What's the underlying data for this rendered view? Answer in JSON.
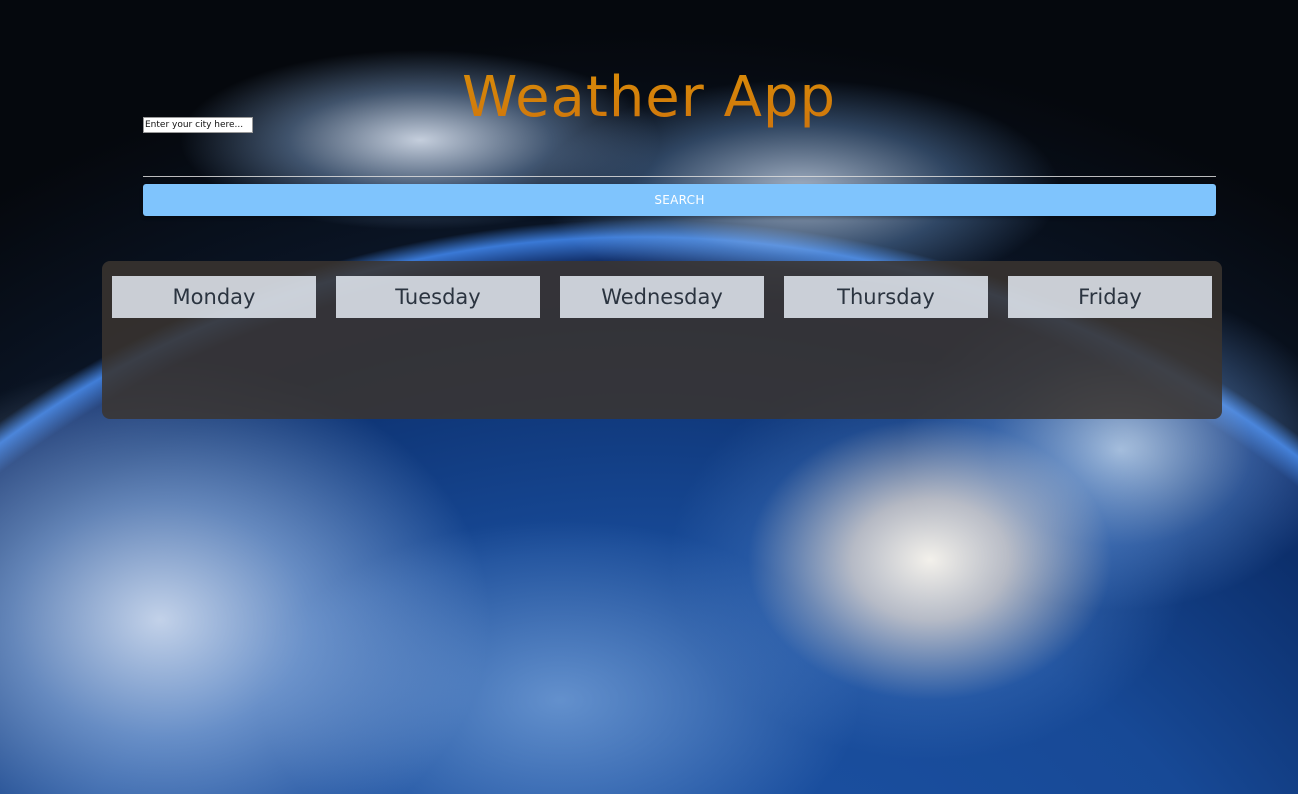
{
  "app": {
    "title": "Weather App"
  },
  "search": {
    "placeholder": "Enter your city here...",
    "value": "",
    "button_label": "SEARCH"
  },
  "forecast": {
    "days": [
      {
        "label": "Monday"
      },
      {
        "label": "Tuesday"
      },
      {
        "label": "Wednesday"
      },
      {
        "label": "Thursday"
      },
      {
        "label": "Friday"
      }
    ]
  },
  "colors": {
    "title": "#d6830a",
    "button": "#7fc4fd",
    "panel": "#3a3430"
  }
}
